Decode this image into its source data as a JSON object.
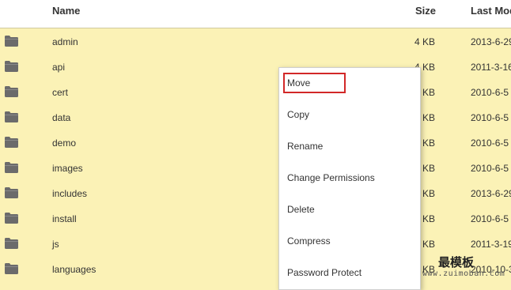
{
  "header": {
    "name_label": "Name",
    "size_label": "Size",
    "modified_label": "Last Mod"
  },
  "files": [
    {
      "name": "admin",
      "size": "4 KB",
      "modified": "2013-6-29"
    },
    {
      "name": "api",
      "size": "4 KB",
      "modified": "2011-3-16"
    },
    {
      "name": "cert",
      "size": "4 KB",
      "modified": "2010-6-5"
    },
    {
      "name": "data",
      "size": "4 KB",
      "modified": "2010-6-5"
    },
    {
      "name": "demo",
      "size": "4 KB",
      "modified": "2010-6-5"
    },
    {
      "name": "images",
      "size": "4 KB",
      "modified": "2010-6-5"
    },
    {
      "name": "includes",
      "size": "4 KB",
      "modified": "2013-6-29"
    },
    {
      "name": "install",
      "size": "4 KB",
      "modified": "2010-6-5"
    },
    {
      "name": "js",
      "size": "4 KB",
      "modified": "2011-3-19"
    },
    {
      "name": "languages",
      "size": "4 KB",
      "modified": "2010-10-3"
    }
  ],
  "context_menu": {
    "items": [
      "Move",
      "Copy",
      "Rename",
      "Change Permissions",
      "Delete",
      "Compress",
      "Password Protect"
    ],
    "highlighted": "Move"
  },
  "watermark": {
    "title": "最模板",
    "url": "www.zuimoban.com"
  },
  "colors": {
    "row_background": "#fbf2b6",
    "header_background": "#ffffff",
    "folder_icon": "#6b6b6b",
    "highlight_border": "#d22828"
  },
  "icons": {
    "row": "folder-icon"
  }
}
